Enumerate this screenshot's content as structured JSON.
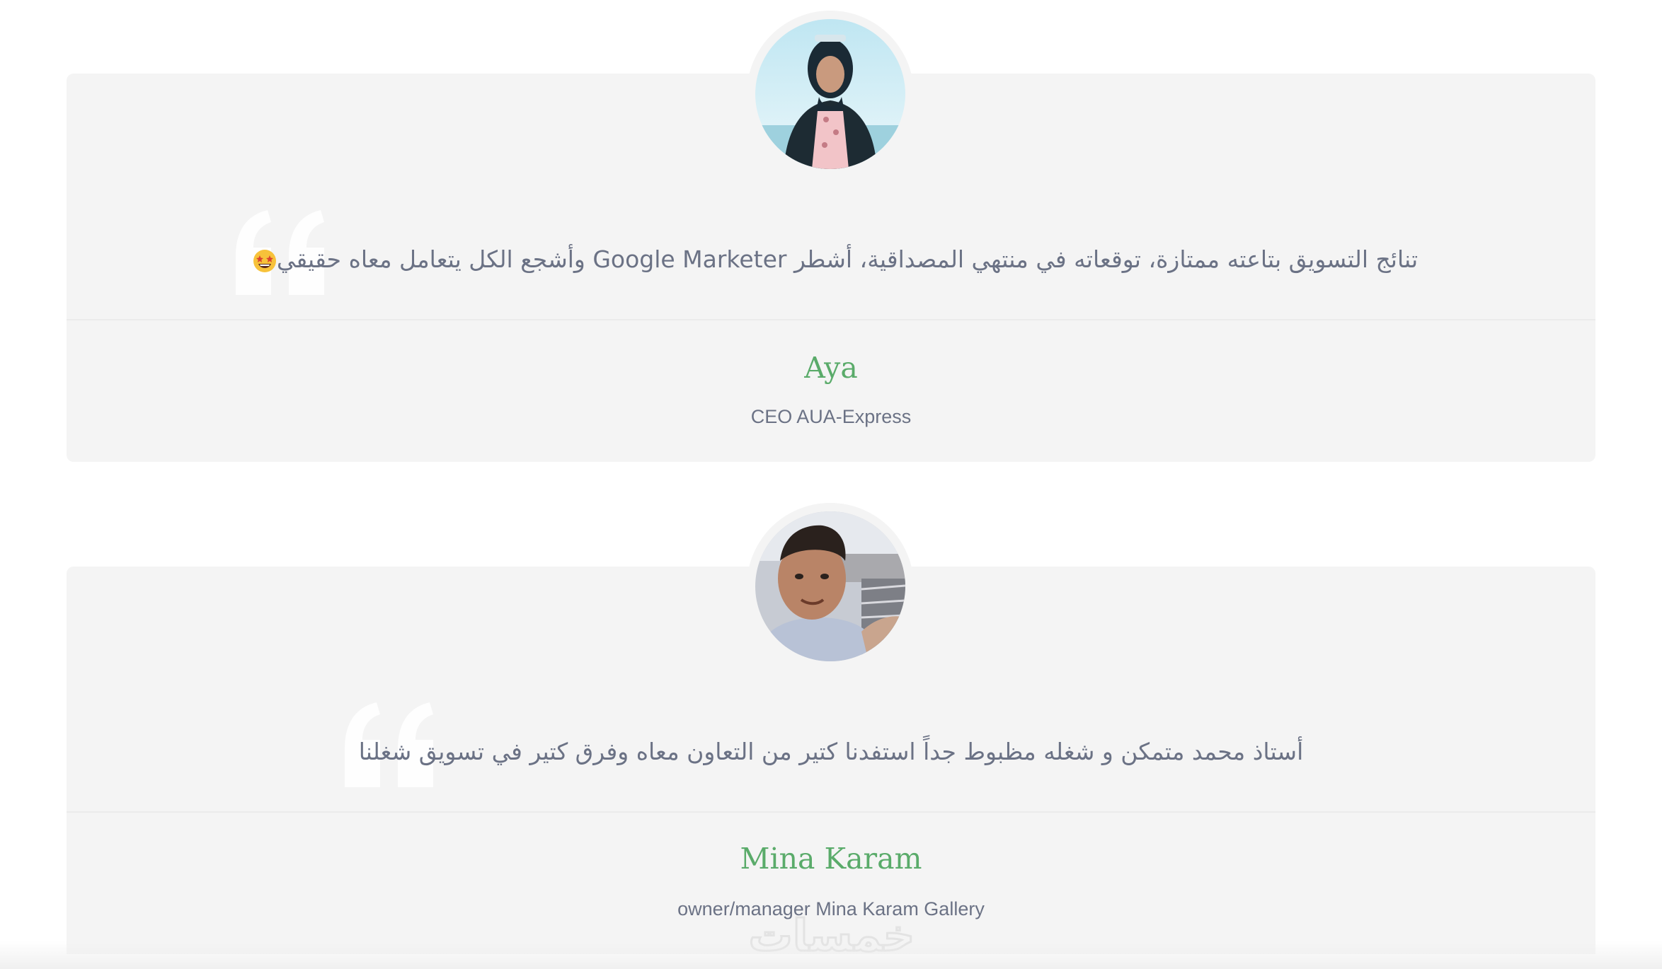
{
  "testimonials": [
    {
      "quote": "تنائج التسويق بتاعته ممتازة، توقعاته في منتهي المصداقية، أشطر Google Marketer وأشجع الكل يتعامل معاه حقيقي",
      "emoji": "star-struck-emoji",
      "name": "Aya",
      "role": "CEO AUA-Express",
      "avatar": "avatar-photo-woman"
    },
    {
      "quote": "أستاذ محمد متمكن و شغله مظبوط جداً استفدنا كتير من التعاون معاه وفرق كتير في تسويق شغلنا",
      "name": "Mina Karam",
      "role": "owner/manager Mina Karam Gallery",
      "avatar": "avatar-photo-man"
    }
  ],
  "watermark": "خمسات",
  "colors": {
    "card_bg": "#f4f4f4",
    "name": "#5aab6a",
    "text": "#6b7285",
    "quote_mark": "#ffffff"
  }
}
